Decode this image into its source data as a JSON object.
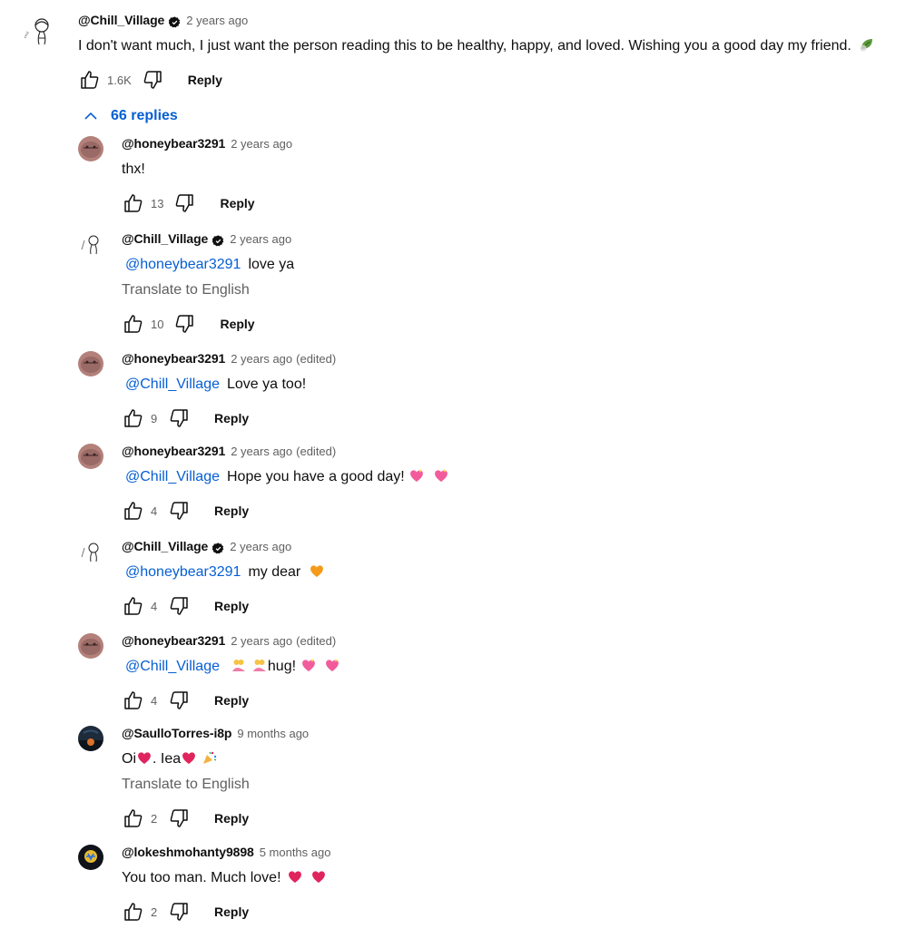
{
  "top_comment": {
    "author": "@Chill_Village",
    "time": "2 years ago",
    "text": "I don't want much, I just want the person reading this to be healthy, happy, and loved. Wishing you a good day my friend.",
    "likes": "1.6K",
    "reply_label": "Reply"
  },
  "replies_toggle": {
    "label": "66 replies"
  },
  "replies": [
    {
      "author": "@honeybear3291",
      "time": "2 years ago",
      "edited": "",
      "mention": "",
      "text": "thx!",
      "translate": "",
      "likes": "13",
      "reply_label": "Reply"
    },
    {
      "author": "@Chill_Village",
      "time": "2 years ago",
      "edited": "",
      "mention": "@honeybear3291",
      "text": "love ya",
      "translate": "Translate to English",
      "likes": "10",
      "reply_label": "Reply"
    },
    {
      "author": "@honeybear3291",
      "time": "2 years ago",
      "edited": "(edited)",
      "mention": "@Chill_Village",
      "text": "Love ya too!",
      "translate": "",
      "likes": "9",
      "reply_label": "Reply"
    },
    {
      "author": "@honeybear3291",
      "time": "2 years ago",
      "edited": "(edited)",
      "mention": "@Chill_Village",
      "text": "Hope you have a good day!",
      "translate": "",
      "likes": "4",
      "reply_label": "Reply"
    },
    {
      "author": "@Chill_Village",
      "time": "2 years ago",
      "edited": "",
      "mention": "@honeybear3291",
      "text": "my dear",
      "translate": "",
      "likes": "4",
      "reply_label": "Reply"
    },
    {
      "author": "@honeybear3291",
      "time": "2 years ago",
      "edited": "(edited)",
      "mention": "@Chill_Village",
      "text": "hug!",
      "translate": "",
      "likes": "4",
      "reply_label": "Reply"
    },
    {
      "author": "@SaulloTorres-i8p",
      "time": "9 months ago",
      "edited": "",
      "mention": "",
      "text_parts": [
        "Oi",
        ".  Iea"
      ],
      "translate": "Translate to English",
      "likes": "2",
      "reply_label": "Reply"
    },
    {
      "author": "@lokeshmohanty9898",
      "time": "5 months ago",
      "edited": "",
      "mention": "",
      "text": "You too man. Much love!",
      "translate": "",
      "likes": "2",
      "reply_label": "Reply"
    }
  ],
  "colors": {
    "link": "#065fd4",
    "secondary_text": "#606060",
    "heart": "#e0245e",
    "sparkle_heart": "#f25c9c",
    "orange_heart": "#f59a1a"
  }
}
